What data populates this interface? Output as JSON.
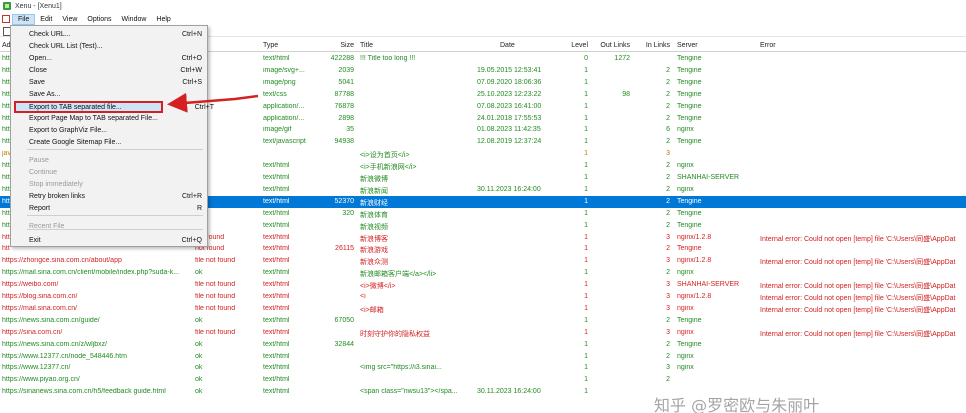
{
  "window": {
    "title": "Xenu - [Xenu1]"
  },
  "menubar": {
    "items": [
      "File",
      "Edit",
      "View",
      "Options",
      "Window",
      "Help"
    ],
    "active": "File"
  },
  "columns": [
    "Ad",
    "Type",
    "Size",
    "Title",
    "Date",
    "Level",
    "Out Links",
    "In Links",
    "Server",
    "Error"
  ],
  "file_menu": {
    "items": [
      {
        "label": "Check URL...",
        "shortcut": "Ctrl+N",
        "disabled": false
      },
      {
        "label": "Check URL List (Test)...",
        "shortcut": "",
        "disabled": false
      },
      {
        "label": "Open...",
        "shortcut": "Ctrl+O",
        "disabled": false
      },
      {
        "label": "Close",
        "shortcut": "Ctrl+W",
        "disabled": false
      },
      {
        "label": "Save",
        "shortcut": "Ctrl+S",
        "disabled": false
      },
      {
        "label": "Save As...",
        "shortcut": "",
        "disabled": false
      },
      {
        "label": "Export to TAB separated file...",
        "shortcut": "Ctrl+T",
        "disabled": false,
        "highlighted": true
      },
      {
        "label": "Export Page Map to TAB separated File...",
        "shortcut": "",
        "disabled": false
      },
      {
        "label": "Export to GraphViz File...",
        "shortcut": "",
        "disabled": false
      },
      {
        "label": "Create Google Sitemap File...",
        "shortcut": "",
        "disabled": false
      },
      {
        "label": "Pause",
        "shortcut": "",
        "disabled": true
      },
      {
        "label": "Continue",
        "shortcut": "",
        "disabled": true
      },
      {
        "label": "Stop immediately",
        "shortcut": "",
        "disabled": true
      },
      {
        "label": "Retry broken links",
        "shortcut": "Ctrl+R",
        "disabled": false
      },
      {
        "label": "Report",
        "shortcut": "R",
        "disabled": false
      },
      {
        "label": "Recent File",
        "shortcut": "",
        "disabled": true
      },
      {
        "label": "Exit",
        "shortcut": "Ctrl+Q",
        "disabled": false
      }
    ]
  },
  "rows": [
    {
      "addr": "htt",
      "status": "",
      "type": "text/html",
      "size": "422288",
      "title": "!!! Title too long !!!",
      "date": "",
      "level": "0",
      "out": "1272",
      "in": "",
      "server": "Tengine",
      "error": ""
    },
    {
      "addr": "htt",
      "status": "",
      "type": "image/svg+...",
      "size": "2039",
      "title": "",
      "date": "19.05.2015 12:53:41",
      "level": "1",
      "out": "",
      "in": "2",
      "server": "Tengine",
      "error": ""
    },
    {
      "addr": "htt",
      "status": "",
      "type": "image/png",
      "size": "5041",
      "title": "",
      "date": "07.09.2020 18:06:36",
      "level": "1",
      "out": "",
      "in": "2",
      "server": "Tengine",
      "error": ""
    },
    {
      "addr": "htt",
      "status": "",
      "type": "text/css",
      "size": "87788",
      "title": "",
      "date": "25.10.2023 12:23:22",
      "level": "1",
      "out": "98",
      "in": "2",
      "server": "Tengine",
      "error": ""
    },
    {
      "addr": "htt",
      "status": "",
      "type": "application/...",
      "size": "76878",
      "title": "",
      "date": "07.08.2023 16:41:00",
      "level": "1",
      "out": "",
      "in": "2",
      "server": "Tengine",
      "error": ""
    },
    {
      "addr": "htt",
      "status": "",
      "type": "application/...",
      "size": "2898",
      "title": "",
      "date": "24.01.2018 17:55:53",
      "level": "1",
      "out": "",
      "in": "2",
      "server": "Tengine",
      "error": ""
    },
    {
      "addr": "htt",
      "status": "",
      "type": "image/gif",
      "size": "35",
      "title": "",
      "date": "01.08.2023 11:42:35",
      "level": "1",
      "out": "",
      "in": "6",
      "server": "nginx",
      "error": ""
    },
    {
      "addr": "htt",
      "status": "",
      "type": "text/javascript",
      "size": "94938",
      "title": "",
      "date": "12.08.2019 12:37:24",
      "level": "1",
      "out": "",
      "in": "2",
      "server": "Tengine",
      "error": ""
    },
    {
      "addr": "jav",
      "status": "pe",
      "type": "",
      "size": "",
      "title": "<i>设为首页</i>",
      "date": "",
      "level": "1",
      "out": "",
      "in": "3",
      "server": "",
      "error": ""
    },
    {
      "addr": "htt",
      "status": "",
      "type": "text/html",
      "size": "",
      "title": "<i>手机新浪网</i>",
      "date": "",
      "level": "1",
      "out": "",
      "in": "2",
      "server": "nginx",
      "error": ""
    },
    {
      "addr": "htt",
      "status": "",
      "type": "text/html",
      "size": "",
      "title": "新浪微博",
      "date": "",
      "level": "1",
      "out": "",
      "in": "2",
      "server": "SHANHAI-SERVER",
      "error": ""
    },
    {
      "addr": "htt",
      "status": "",
      "type": "text/html",
      "size": "",
      "title": "新浪新闻",
      "date": "30.11.2023 16:24:00",
      "level": "1",
      "out": "",
      "in": "2",
      "server": "nginx",
      "error": ""
    },
    {
      "addr": "htt",
      "status": "",
      "type": "text/html",
      "size": "52370",
      "title": "新浪财经",
      "date": "",
      "level": "1",
      "out": "",
      "in": "2",
      "server": "Tengine",
      "error": "",
      "selected": true
    },
    {
      "addr": "htt",
      "status": "",
      "type": "text/html",
      "size": "320",
      "title": "新浪体育",
      "date": "",
      "level": "1",
      "out": "",
      "in": "2",
      "server": "Tengine",
      "error": ""
    },
    {
      "addr": "htt",
      "status": "",
      "type": "text/html",
      "size": "",
      "title": "新浪视频",
      "date": "",
      "level": "1",
      "out": "",
      "in": "2",
      "server": "Tengine",
      "error": ""
    },
    {
      "addr": "htt",
      "status": "not found",
      "type": "text/html",
      "size": "",
      "title": "新浪博客",
      "date": "",
      "level": "1",
      "out": "",
      "in": "3",
      "server": "nginx/1.2.8",
      "error": "Internal error: Could not open [temp] file 'C:\\Users\\同盛\\AppDat"
    },
    {
      "addr": "htt",
      "status": "not found",
      "type": "text/html",
      "size": "26115",
      "title": "新浪游戏",
      "date": "",
      "level": "1",
      "out": "",
      "in": "2",
      "server": "Tengine",
      "error": ""
    },
    {
      "addr": "https://zhongce.sina.com.cn/about/app",
      "status": "file not found",
      "type": "text/html",
      "size": "",
      "title": "新浪众测",
      "date": "",
      "level": "1",
      "out": "",
      "in": "3",
      "server": "nginx/1.2.8",
      "error": "Internal error: Could not open [temp] file 'C:\\Users\\同盛\\AppDat"
    },
    {
      "addr": "https://mail.sina.com.cn/client/mobile/index.php?suda-k...",
      "status": "ok",
      "type": "text/html",
      "size": "",
      "title": "新浪邮箱客户端</a></li>",
      "date": "",
      "level": "1",
      "out": "",
      "in": "2",
      "server": "nginx",
      "error": ""
    },
    {
      "addr": "https://weibo.com/",
      "status": "file not found",
      "type": "text/html",
      "size": "",
      "title": "<i>微博</i>",
      "date": "",
      "level": "1",
      "out": "",
      "in": "3",
      "server": "SHANHAI-SERVER",
      "error": "Internal error: Could not open [temp] file 'C:\\Users\\同盛\\AppDat"
    },
    {
      "addr": "https://blog.sina.com.cn/",
      "status": "file not found",
      "type": "text/html",
      "size": "",
      "title": "<i",
      "date": "",
      "level": "1",
      "out": "",
      "in": "3",
      "server": "nginx/1.2.8",
      "error": "Internal error: Could not open [temp] file 'C:\\Users\\同盛\\AppDat"
    },
    {
      "addr": "https://mail.sina.com.cn/",
      "status": "file not found",
      "type": "text/html",
      "size": "",
      "title": "<i>邮箱",
      "date": "",
      "level": "1",
      "out": "",
      "in": "3",
      "server": "nginx",
      "error": "Internal error: Could not open [temp] file 'C:\\Users\\同盛\\AppDat"
    },
    {
      "addr": "https://news.sina.com.cn/guide/",
      "status": "ok",
      "type": "text/html",
      "size": "67050",
      "title": "",
      "date": "",
      "level": "1",
      "out": "",
      "in": "2",
      "server": "Tengine",
      "error": ""
    },
    {
      "addr": "https://sina.com.cn/",
      "status": "file not found",
      "type": "text/html",
      "size": "",
      "title": "时刻守护你的隐私权益",
      "date": "",
      "level": "1",
      "out": "",
      "in": "3",
      "server": "nginx",
      "error": "Internal error: Could not open [temp] file 'C:\\Users\\同盛\\AppDat"
    },
    {
      "addr": "https://news.sina.com.cn/z/wljbxz/",
      "status": "ok",
      "type": "text/html",
      "size": "32844",
      "title": "",
      "date": "",
      "level": "1",
      "out": "",
      "in": "2",
      "server": "Tengine",
      "error": ""
    },
    {
      "addr": "https://www.12377.cn/node_548446.htm",
      "status": "ok",
      "type": "text/html",
      "size": "",
      "title": "",
      "date": "",
      "level": "1",
      "out": "",
      "in": "2",
      "server": "nginx",
      "error": ""
    },
    {
      "addr": "https://www.12377.cn/",
      "status": "ok",
      "type": "text/html",
      "size": "",
      "title": "<img src=\"https://i3.sinai...",
      "date": "",
      "level": "1",
      "out": "",
      "in": "3",
      "server": "nginx",
      "error": ""
    },
    {
      "addr": "https://www.piyao.org.cn/",
      "status": "ok",
      "type": "text/html",
      "size": "",
      "title": "",
      "date": "",
      "level": "1",
      "out": "",
      "in": "2",
      "server": "",
      "error": ""
    },
    {
      "addr": "https://sinanews.sina.com.cn/h5/feedback guide.html",
      "status": "ok",
      "type": "text/html",
      "size": "",
      "title": "<span class=\"nwsu13\"></spa...",
      "date": "30.11.2023 16:24:00",
      "level": "1",
      "out": "",
      "in": "",
      "server": "",
      "error": ""
    }
  ],
  "watermark": "知乎 @罗密欧与朱丽叶",
  "colors": {
    "ok": "#228b22",
    "error": "#d42020",
    "selected": "#0078d7",
    "highlight_border": "#d42020"
  }
}
